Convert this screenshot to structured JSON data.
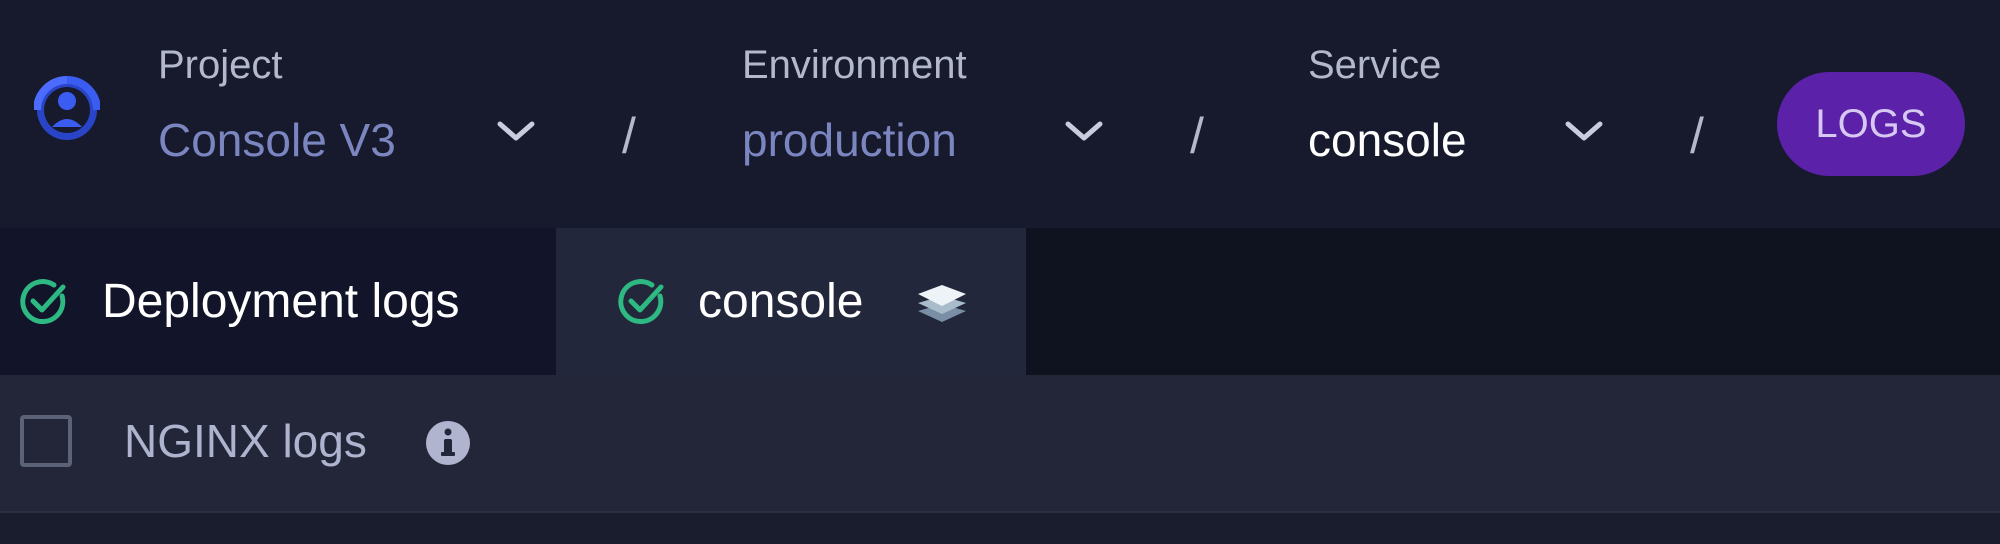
{
  "header": {
    "project": {
      "label": "Project",
      "value": "Console V3"
    },
    "environment": {
      "label": "Environment",
      "value": "production"
    },
    "service": {
      "label": "Service",
      "value": "console"
    },
    "separator": "/",
    "logs_button": "LOGS"
  },
  "tabs": [
    {
      "label": "Deployment logs",
      "status_icon": "check-circle-icon"
    },
    {
      "label": "console",
      "status_icon": "check-circle-icon",
      "extra_icon": "stack-layers-icon"
    }
  ],
  "options": {
    "nginx_label": "NGINX logs",
    "nginx_checked": false
  },
  "colors": {
    "accent_purple": "#5b21a8",
    "link_blue": "#7b85c0",
    "success_green": "#2fb982",
    "logo_blue": "#3b5cf0"
  }
}
